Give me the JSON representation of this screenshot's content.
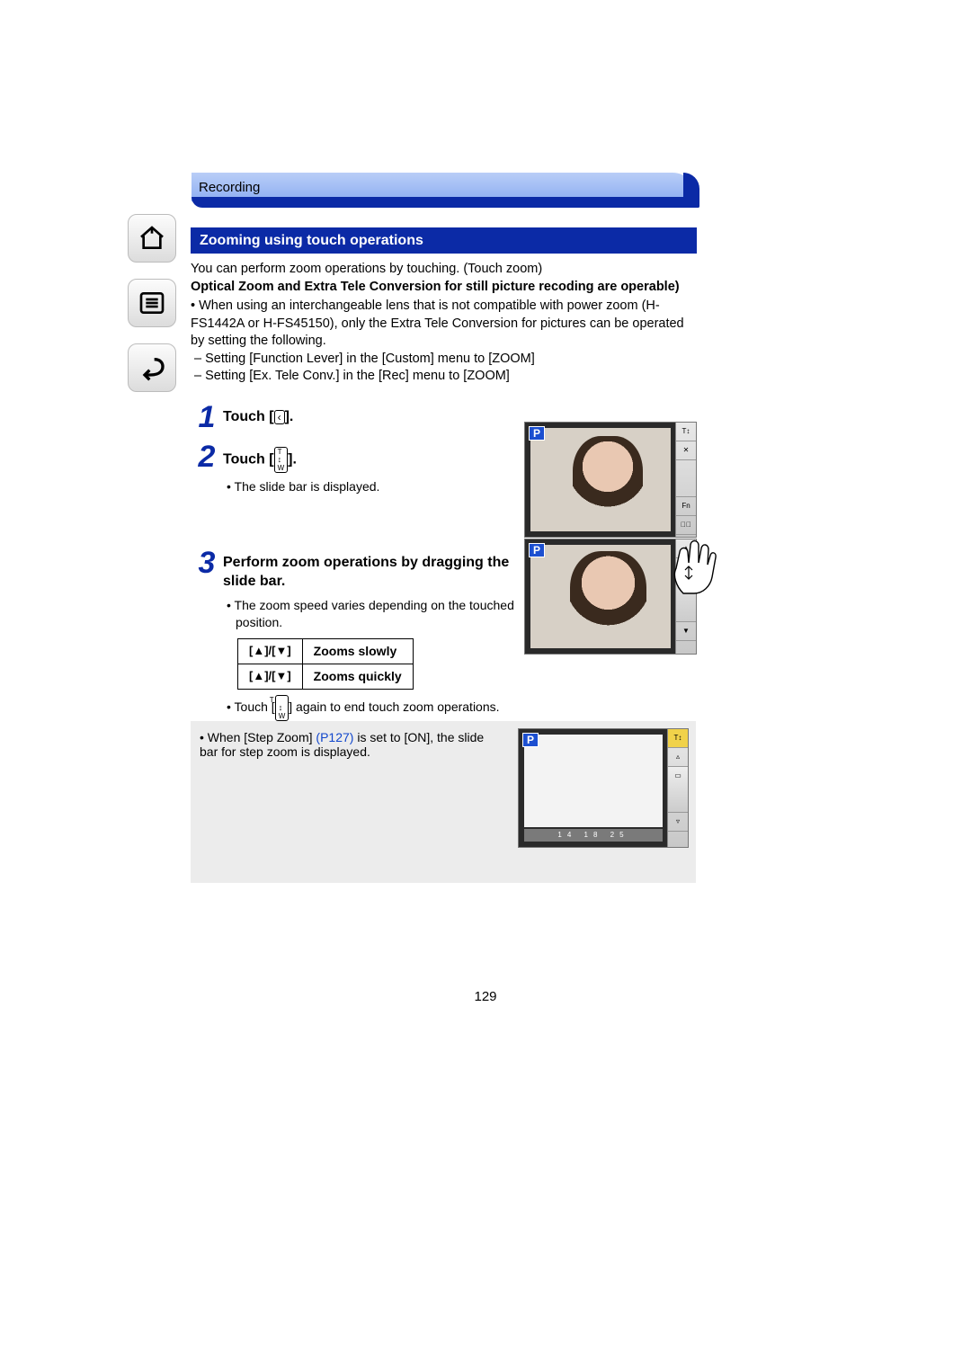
{
  "header": {
    "breadcrumb": "Recording"
  },
  "section_title": "Zooming using touch operations",
  "intro": {
    "l1": "You can perform zoom operations by touching. (Touch zoom)",
    "l2": "Optical Zoom and Extra Tele Conversion for still picture recoding are operable)",
    "l3": "• When using an interchangeable lens that is not compatible with power zoom (H-FS1442A or H-FS45150), only the Extra Tele Conversion for pictures can be operated by setting the following.",
    "l4": "– Setting [Function Lever] in the [Custom] menu to [ZOOM]",
    "l5": "– Setting [Ex. Tele Conv.] in the [Rec] menu to [ZOOM]"
  },
  "steps": {
    "s1": {
      "num": "1",
      "title_pre": "Touch [",
      "title_post": "]."
    },
    "s2": {
      "num": "2",
      "title_pre": "Touch [",
      "title_post": "].",
      "sub": "• The slide bar is displayed."
    },
    "s3": {
      "num": "3",
      "title": "Perform zoom operations by dragging the slide bar.",
      "sub": "• The zoom speed varies depending on the touched position.",
      "after": "• Touch [",
      "after2": "] again to end touch zoom operations."
    }
  },
  "table": {
    "r1": {
      "keys": "[▲]/[▼]",
      "desc": "Zooms slowly"
    },
    "r2": {
      "keys": "[▲]/[▼]",
      "desc": "Zooms quickly"
    }
  },
  "note": {
    "pre": "• When [Step Zoom] ",
    "link": "(P127)",
    "post": " is set to [ON], the slide bar for step zoom is displayed."
  },
  "icons": {
    "tab": "‹",
    "tw": "T↕W",
    "tw2": "T↕W"
  },
  "screens": {
    "mode": "P",
    "zoom_marks": "14  18  25"
  },
  "page_number": "129"
}
